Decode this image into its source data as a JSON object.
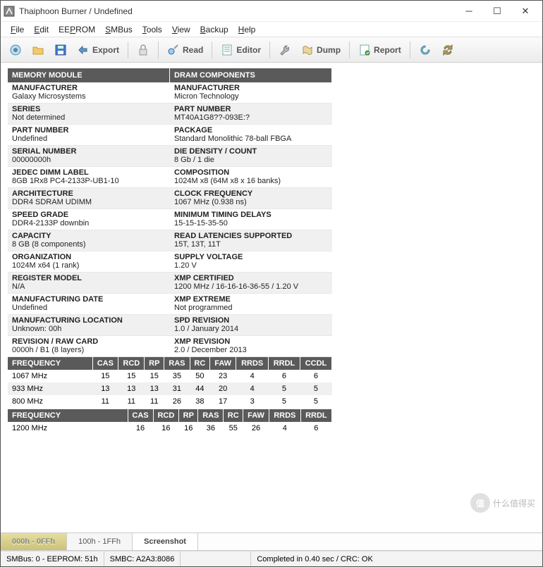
{
  "title": "Thaiphoon Burner / Undefined",
  "menu": [
    "File",
    "Edit",
    "EEPROM",
    "SMBus",
    "Tools",
    "View",
    "Backup",
    "Help"
  ],
  "toolbar": {
    "export": "Export",
    "read": "Read",
    "editor": "Editor",
    "dump": "Dump",
    "report": "Report"
  },
  "section_headers": {
    "left": "MEMORY MODULE",
    "right": "DRAM COMPONENTS"
  },
  "module": [
    {
      "label": "MANUFACTURER",
      "value": "Galaxy Microsystems"
    },
    {
      "label": "SERIES",
      "value": "Not determined"
    },
    {
      "label": "PART NUMBER",
      "value": "Undefined"
    },
    {
      "label": "SERIAL NUMBER",
      "value": "00000000h"
    },
    {
      "label": "JEDEC DIMM LABEL",
      "value": "8GB 1Rx8 PC4-2133P-UB1-10"
    },
    {
      "label": "ARCHITECTURE",
      "value": "DDR4 SDRAM UDIMM"
    },
    {
      "label": "SPEED GRADE",
      "value": "DDR4-2133P downbin"
    },
    {
      "label": "CAPACITY",
      "value": "8 GB (8 components)"
    },
    {
      "label": "ORGANIZATION",
      "value": "1024M x64 (1 rank)"
    },
    {
      "label": "REGISTER MODEL",
      "value": "N/A"
    },
    {
      "label": "MANUFACTURING DATE",
      "value": "Undefined"
    },
    {
      "label": "MANUFACTURING LOCATION",
      "value": "Unknown: 00h"
    },
    {
      "label": "REVISION / RAW CARD",
      "value": "0000h / B1 (8 layers)"
    }
  ],
  "dram": [
    {
      "label": "MANUFACTURER",
      "value": "Micron Technology"
    },
    {
      "label": "PART NUMBER",
      "value": "MT40A1G8??-093E:?"
    },
    {
      "label": "PACKAGE",
      "value": "Standard Monolithic 78-ball FBGA"
    },
    {
      "label": "DIE DENSITY / COUNT",
      "value": "8 Gb / 1 die"
    },
    {
      "label": "COMPOSITION",
      "value": "1024M x8 (64M x8 x 16 banks)"
    },
    {
      "label": "CLOCK FREQUENCY",
      "value": "1067 MHz (0.938 ns)"
    },
    {
      "label": "MINIMUM TIMING DELAYS",
      "value": "15-15-15-35-50"
    },
    {
      "label": "READ LATENCIES SUPPORTED",
      "value": "15T, 13T, 11T"
    },
    {
      "label": "SUPPLY VOLTAGE",
      "value": "1.20 V"
    },
    {
      "label": "XMP CERTIFIED",
      "value": "1200 MHz / 16-16-16-36-55 / 1.20 V"
    },
    {
      "label": "XMP EXTREME",
      "value": "Not programmed"
    },
    {
      "label": "SPD REVISION",
      "value": "1.0 / January 2014"
    },
    {
      "label": "XMP REVISION",
      "value": "2.0 / December 2013"
    }
  ],
  "timing1": {
    "headers": [
      "FREQUENCY",
      "CAS",
      "RCD",
      "RP",
      "RAS",
      "RC",
      "FAW",
      "RRDS",
      "RRDL",
      "CCDL"
    ],
    "rows": [
      [
        "1067 MHz",
        "15",
        "15",
        "15",
        "35",
        "50",
        "23",
        "4",
        "6",
        "6"
      ],
      [
        "933 MHz",
        "13",
        "13",
        "13",
        "31",
        "44",
        "20",
        "4",
        "5",
        "5"
      ],
      [
        "800 MHz",
        "11",
        "11",
        "11",
        "26",
        "38",
        "17",
        "3",
        "5",
        "5"
      ]
    ]
  },
  "timing2": {
    "headers": [
      "FREQUENCY",
      "CAS",
      "RCD",
      "RP",
      "RAS",
      "RC",
      "FAW",
      "RRDS",
      "RRDL"
    ],
    "rows": [
      [
        "1200 MHz",
        "16",
        "16",
        "16",
        "36",
        "55",
        "26",
        "4",
        "6"
      ]
    ]
  },
  "bottom_tabs": [
    "000h - 0FFh",
    "100h - 1FFh",
    "Screenshot"
  ],
  "status": {
    "smbus": "SMBus: 0 - EEPROM: 51h",
    "smbc": "SMBC: A2A3:8086",
    "result": "Completed in 0.40 sec / CRC: OK"
  },
  "watermark": "什么值得买"
}
